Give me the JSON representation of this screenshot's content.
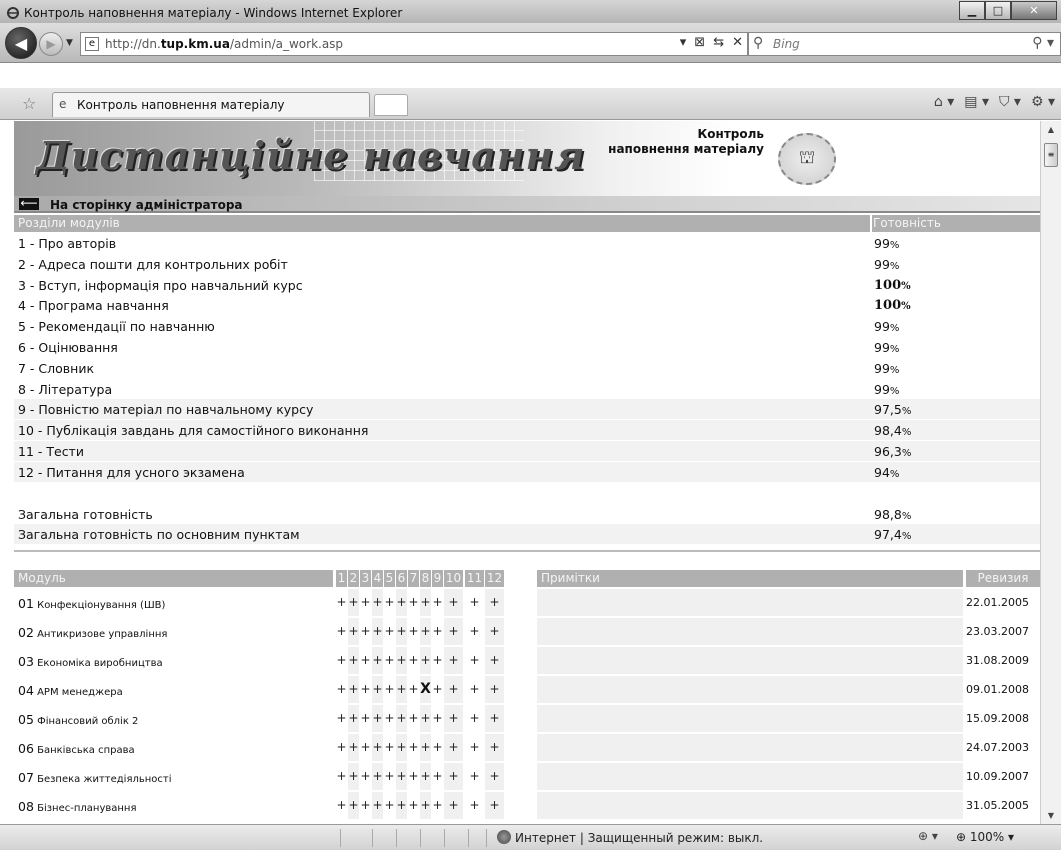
{
  "window": {
    "title": "Контроль наповнення матеріалу - Windows Internet Explorer",
    "address_plain_prefix": "http://dn.",
    "address_bold": "tup.km.ua",
    "address_plain_suffix": "/admin/a_work.asp",
    "search_placeholder": "Bing",
    "tab_label": "Контроль наповнення матеріалу"
  },
  "header": {
    "logo_text": "Дистанційне навчання",
    "title_line1": "Контроль",
    "title_line2": "наповнення матеріалу",
    "admin_link": "На сторінку адміністратора"
  },
  "sections": {
    "col_name": "Розділи модулів",
    "col_ready": "Готовність",
    "rows": [
      {
        "label": "1 - Про авторів",
        "value": "99",
        "unit": "%",
        "bold": false,
        "shade": false
      },
      {
        "label": "2 - Адреса пошти для контрольних робіт",
        "value": "99",
        "unit": "%",
        "bold": false,
        "shade": false
      },
      {
        "label": "3 - Вступ, інформація про навчальний курс",
        "value": "100",
        "unit": "%",
        "bold": true,
        "shade": false
      },
      {
        "label": "4 - Програма навчання",
        "value": "100",
        "unit": "%",
        "bold": true,
        "shade": false
      },
      {
        "label": "5 - Рекомендації по навчанню",
        "value": "99",
        "unit": "%",
        "bold": false,
        "shade": false
      },
      {
        "label": "6 - Оцінювання",
        "value": "99",
        "unit": "%",
        "bold": false,
        "shade": false
      },
      {
        "label": "7 - Словник",
        "value": "99",
        "unit": "%",
        "bold": false,
        "shade": false
      },
      {
        "label": "8 - Література",
        "value": "99",
        "unit": "%",
        "bold": false,
        "shade": false
      },
      {
        "label": "9 - Повністю матеріал по навчальному курсу",
        "value": "97,5",
        "unit": "%",
        "bold": false,
        "shade": true
      },
      {
        "label": "10 - Публікація завдань для самостійного виконання",
        "value": "98,4",
        "unit": "%",
        "bold": false,
        "shade": true
      },
      {
        "label": "11 - Тести",
        "value": "96,3",
        "unit": "%",
        "bold": false,
        "shade": true
      },
      {
        "label": "12 - Питання для усного экзамена",
        "value": "94",
        "unit": "%",
        "bold": false,
        "shade": true
      }
    ],
    "total_label": "Загальна готовність",
    "total_value": "98,8",
    "total_main_label": "Загальна готовність по основним пунктам",
    "total_main_value": "97,4",
    "unit": "%"
  },
  "modules": {
    "col_module": "Модуль",
    "col_numbers": [
      "1",
      "2",
      "3",
      "4",
      "5",
      "6",
      "7",
      "8",
      "9",
      "10",
      "11",
      "12"
    ],
    "col_notes": "Примітки",
    "col_revision": "Ревизия",
    "rows": [
      {
        "id": "01",
        "name": "Конфекціонування (ШВ)",
        "marks": [
          "+",
          "+",
          "+",
          "+",
          "+",
          "+",
          "+",
          "+",
          "+",
          "+",
          "+",
          "+"
        ],
        "revision": "22.01.2005"
      },
      {
        "id": "02",
        "name": "Антикризове управління",
        "marks": [
          "+",
          "+",
          "+",
          "+",
          "+",
          "+",
          "+",
          "+",
          "+",
          "+",
          "+",
          "+"
        ],
        "revision": "23.03.2007"
      },
      {
        "id": "03",
        "name": "Економіка виробництва",
        "marks": [
          "+",
          "+",
          "+",
          "+",
          "+",
          "+",
          "+",
          "+",
          "+",
          "+",
          "+",
          "+"
        ],
        "revision": "31.08.2009"
      },
      {
        "id": "04",
        "name": "АРМ менеджера",
        "marks": [
          "+",
          "+",
          "+",
          "+",
          "+",
          "+",
          "+",
          "X",
          "+",
          "+",
          "+",
          "+"
        ],
        "revision": "09.01.2008"
      },
      {
        "id": "05",
        "name": "Фінансовий облік 2",
        "marks": [
          "+",
          "+",
          "+",
          "+",
          "+",
          "+",
          "+",
          "+",
          "+",
          "+",
          "+",
          "+"
        ],
        "revision": "15.09.2008"
      },
      {
        "id": "06",
        "name": "Банківська справа",
        "marks": [
          "+",
          "+",
          "+",
          "+",
          "+",
          "+",
          "+",
          "+",
          "+",
          "+",
          "+",
          "+"
        ],
        "revision": "24.07.2003"
      },
      {
        "id": "07",
        "name": "Безпека життедіяльності",
        "marks": [
          "+",
          "+",
          "+",
          "+",
          "+",
          "+",
          "+",
          "+",
          "+",
          "+",
          "+",
          "+"
        ],
        "revision": "10.09.2007"
      },
      {
        "id": "08",
        "name": "Бізнес-планування",
        "marks": [
          "+",
          "+",
          "+",
          "+",
          "+",
          "+",
          "+",
          "+",
          "+",
          "+",
          "+",
          "+"
        ],
        "revision": "31.05.2005"
      }
    ]
  },
  "status": {
    "zone": "Интернет | Защищенный режим: выкл.",
    "zoom": "100%"
  }
}
